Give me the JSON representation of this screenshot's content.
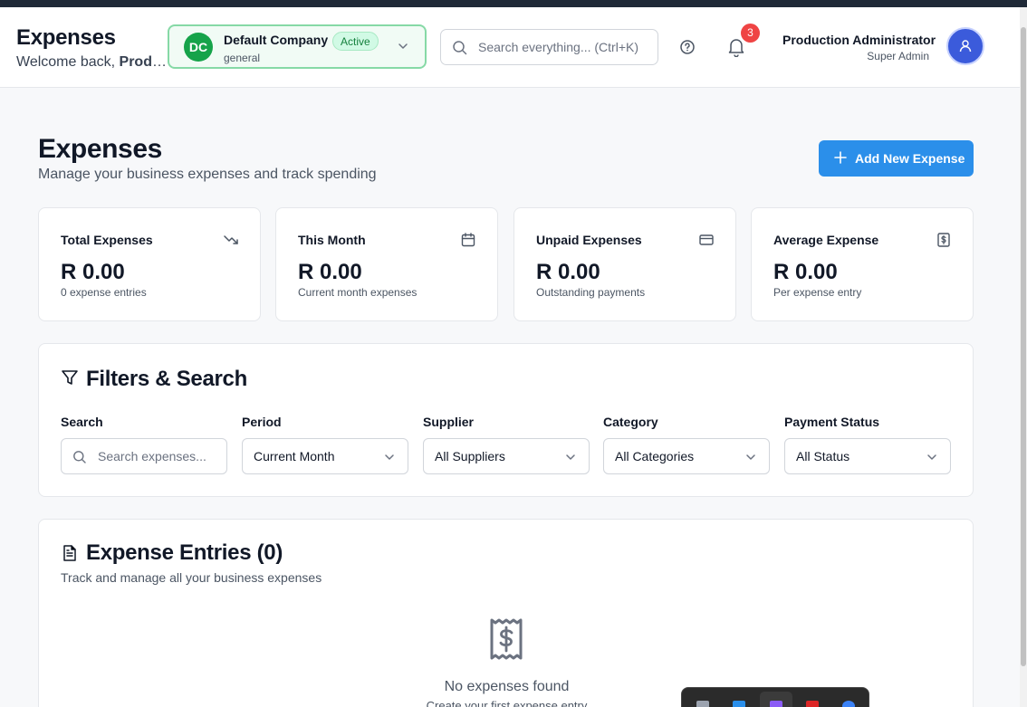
{
  "header": {
    "title": "Expenses",
    "welcome_prefix": "Welcome back, ",
    "welcome_user": "Production Administrator",
    "company": {
      "initials": "DC",
      "name": "Default Company",
      "status": "Active",
      "type": "general"
    },
    "search_placeholder": "Search everything... (Ctrl+K)",
    "notifications_count": "3",
    "user": {
      "name": "Production Administrator",
      "role": "Super Admin"
    }
  },
  "page": {
    "title": "Expenses",
    "subtitle": "Manage your business expenses and track spending",
    "add_button": "Add New Expense"
  },
  "stats": [
    {
      "label": "Total Expenses",
      "value": "R 0.00",
      "desc": "0 expense entries",
      "icon": "trending-down-icon"
    },
    {
      "label": "This Month",
      "value": "R 0.00",
      "desc": "Current month expenses",
      "icon": "calendar-icon"
    },
    {
      "label": "Unpaid Expenses",
      "value": "R 0.00",
      "desc": "Outstanding payments",
      "icon": "credit-card-icon"
    },
    {
      "label": "Average Expense",
      "value": "R 0.00",
      "desc": "Per expense entry",
      "icon": "receipt-dollar-icon"
    }
  ],
  "filters": {
    "title": "Filters & Search",
    "search": {
      "label": "Search",
      "placeholder": "Search expenses..."
    },
    "period": {
      "label": "Period",
      "value": "Current Month"
    },
    "supplier": {
      "label": "Supplier",
      "value": "All Suppliers"
    },
    "category": {
      "label": "Category",
      "value": "All Categories"
    },
    "payment_status": {
      "label": "Payment Status",
      "value": "All Status"
    }
  },
  "entries": {
    "title": "Expense Entries (0)",
    "subtitle": "Track and manage all your business expenses",
    "empty_title": "No expenses found",
    "empty_sub": "Create your first expense entry"
  },
  "colors": {
    "primary": "#2b8fea",
    "company_green": "#16a34a",
    "badge_red": "#ef4444",
    "avatar_blue": "#3b5bdb"
  }
}
